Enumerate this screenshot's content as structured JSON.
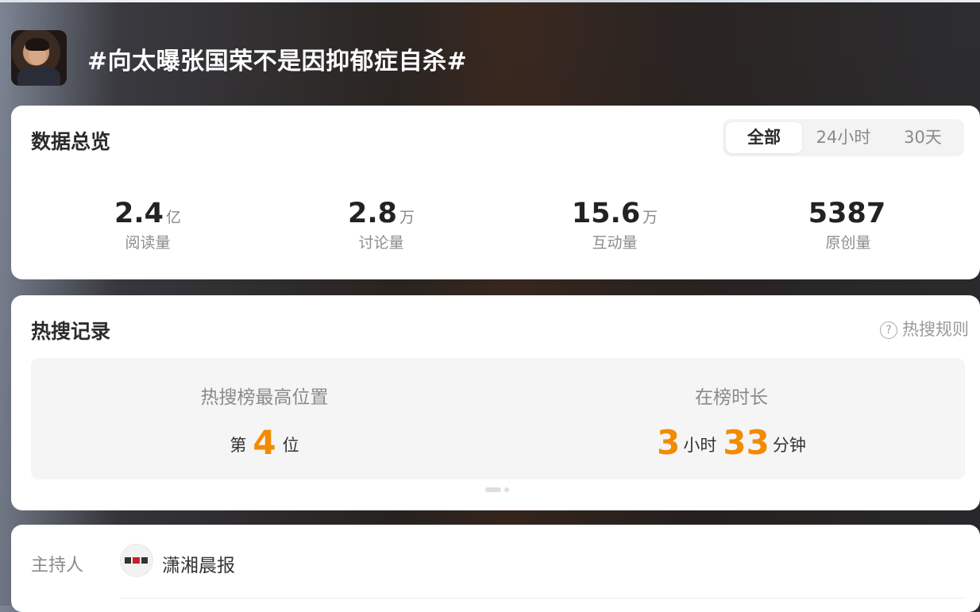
{
  "header": {
    "title": "#向太曝张国荣不是因抑郁症自杀#"
  },
  "overview": {
    "title": "数据总览",
    "tabs": [
      {
        "label": "全部",
        "active": true
      },
      {
        "label": "24小时",
        "active": false
      },
      {
        "label": "30天",
        "active": false
      }
    ],
    "stats": [
      {
        "value": "2.4",
        "unit": "亿",
        "label": "阅读量"
      },
      {
        "value": "2.8",
        "unit": "万",
        "label": "讨论量"
      },
      {
        "value": "15.6",
        "unit": "万",
        "label": "互动量"
      },
      {
        "value": "5387",
        "unit": "",
        "label": "原创量"
      }
    ]
  },
  "hot_search": {
    "title": "热搜记录",
    "rules_label": "热搜规则",
    "rules_icon": "question-circle-icon",
    "highest": {
      "label": "热搜榜最高位置",
      "prefix": "第",
      "value": "4",
      "suffix": "位"
    },
    "duration": {
      "label": "在榜时长",
      "hours": "3",
      "hours_unit": "小时",
      "minutes": "33",
      "minutes_unit": "分钟"
    },
    "accent_color": "#f28b00"
  },
  "host": {
    "label": "主持人",
    "name": "潇湘晨报"
  }
}
